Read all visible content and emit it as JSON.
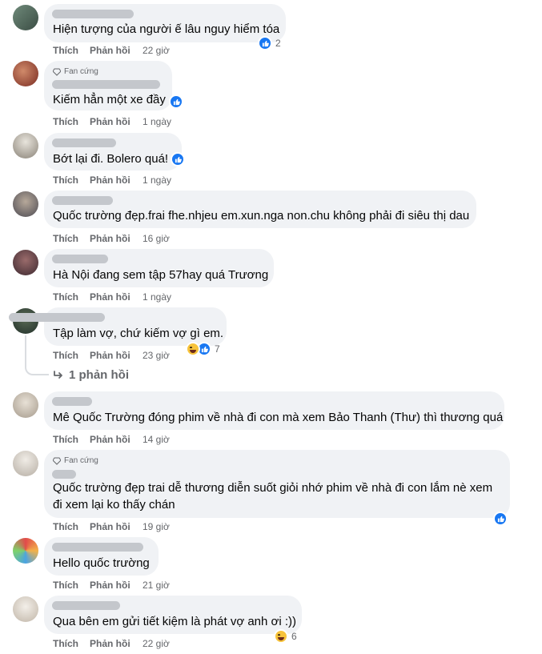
{
  "actions": {
    "like": "Thích",
    "reply": "Phản hồi"
  },
  "fan_badge": "Fan cứng",
  "comments": [
    {
      "text": "Hiện tượng của người ế lâu nguy hiểm tóa",
      "time": "22 giờ",
      "reaction_count": "2"
    },
    {
      "text": "Kiếm hẳn một xe đầy",
      "time": "1 ngày"
    },
    {
      "text": "Bớt lại đi. Bolero quá!",
      "time": "1 ngày"
    },
    {
      "text": "Quốc trường đẹp.frai fhe.nhjeu em.xun.nga non.chu không phải đi siêu thị dau",
      "time": "16 giờ"
    },
    {
      "text": "Hà Nội đang sem tập 57hay quá Trương",
      "time": "1 ngày"
    },
    {
      "text": "Tập làm vợ, chứ kiếm vợ gì em.",
      "time": "23 giờ",
      "reaction_count": "7"
    },
    {
      "text": "Mê Quốc Trường đóng phim về nhà đi con mà xem Bảo Thanh (Thư) thì thương quá",
      "time": "14 giờ"
    },
    {
      "text": "Quốc trường đẹp trai dễ thương diễn suốt giỏi nhớ phim về nhà đi con lắm nè xem đi xem lại ko thấy chán",
      "time": "19 giờ"
    },
    {
      "text": "Hello quốc trường",
      "time": "21 giờ"
    },
    {
      "text": "Qua bên em gửi tiết kiệm là phát vợ anh ơi :))",
      "time": "22 giờ",
      "reaction_count": "6"
    }
  ],
  "more_replies": "1 phản hồi",
  "colors": {
    "accent": "#1877f2",
    "bubble": "#f0f2f5",
    "meta": "#65676b"
  }
}
